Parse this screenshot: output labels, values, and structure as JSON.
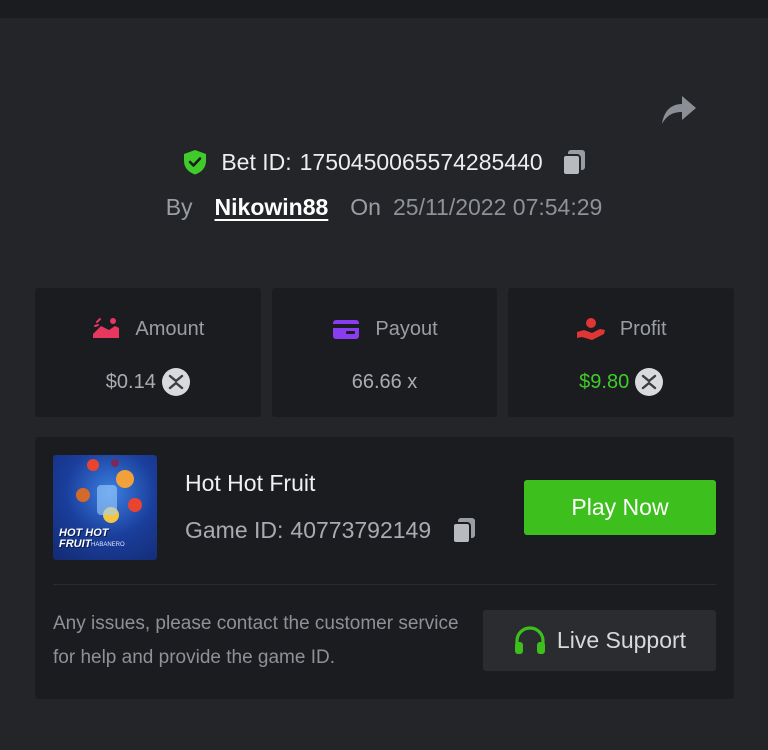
{
  "header": {
    "bet_id_label": "Bet ID:",
    "bet_id": "1750450065574285440",
    "by_label": "By",
    "username": "Nikowin88",
    "on_label": "On",
    "date": "25/11/2022 07:54:29"
  },
  "stats": {
    "amount": {
      "label": "Amount",
      "value": "$0.14"
    },
    "payout": {
      "label": "Payout",
      "value": "66.66 x"
    },
    "profit": {
      "label": "Profit",
      "value": "$9.80"
    }
  },
  "game": {
    "title": "Hot Hot Fruit",
    "game_id_label": "Game ID:",
    "game_id": "40773792149",
    "thumb_logo_line1": "HOT HOT",
    "thumb_logo_line2": "FRUIT",
    "thumb_brand": "HABANERO",
    "play_label": "Play Now"
  },
  "support": {
    "help_text": "Any issues, please contact the customer service for help and provide the game ID.",
    "button_label": "Live Support"
  },
  "colors": {
    "background": "#232528",
    "card": "#1b1c1f",
    "accent_green": "#3dbf1e",
    "profit_green": "#3fcb2a",
    "amount_icon": "#e8375f",
    "payout_icon": "#8a3df0",
    "profit_icon": "#e03535"
  },
  "icons": {
    "share": "share-arrow-icon",
    "verified": "shield-check-icon",
    "copy": "copy-icon",
    "amount": "money-hand-icon",
    "payout": "wallet-card-icon",
    "profit": "hand-coin-icon",
    "coin": "xrp-coin-icon",
    "support": "headset-icon"
  }
}
